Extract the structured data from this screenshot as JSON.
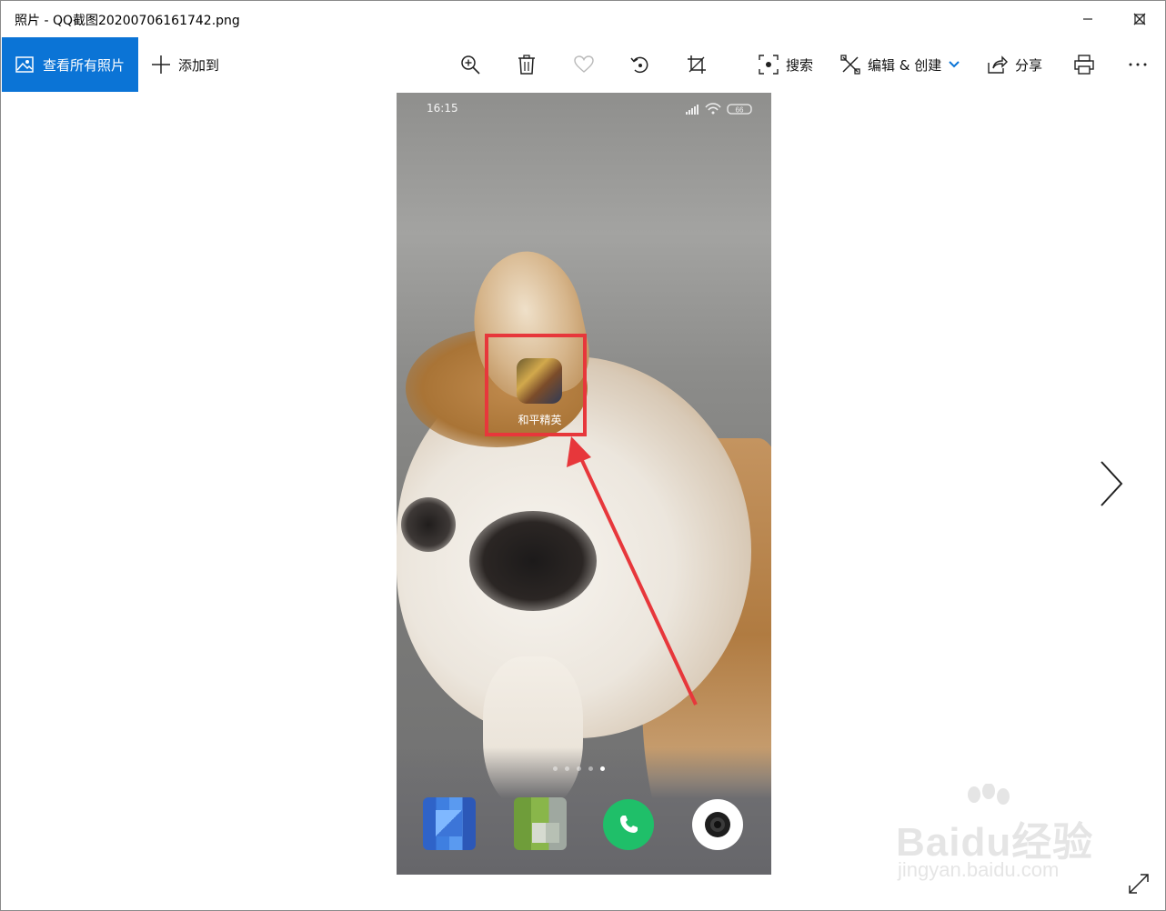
{
  "window": {
    "title": "照片 - QQ截图20200706161742.png"
  },
  "toolbar": {
    "view_all_label": "查看所有照片",
    "add_to_label": "添加到",
    "search_label": "搜索",
    "edit_create_label": "编辑 & 创建",
    "share_label": "分享"
  },
  "photo": {
    "time": "16:15",
    "battery": "66",
    "app_label": "和平精英",
    "page_dots_count": 5,
    "active_page": 5
  },
  "watermark": {
    "main": "Baidu经验",
    "sub": "jingyan.baidu.com"
  },
  "colors": {
    "accent": "#0b74d6",
    "highlight_box": "#e7373b",
    "arrow": "#e7373b",
    "phone_green": "#1fbf69"
  },
  "icons": {
    "view_all": "picture-icon",
    "add": "plus-icon",
    "zoom": "zoom-in-icon",
    "delete": "trash-icon",
    "favorite": "heart-icon",
    "rotate": "rotate-icon",
    "crop": "crop-icon",
    "search": "search-icon",
    "edit": "edit-create-icon",
    "dropdown": "chevron-down-icon",
    "share": "share-icon",
    "print": "print-icon",
    "more": "more-icon",
    "next": "chevron-right-icon",
    "fullscreen": "fullscreen-icon"
  }
}
